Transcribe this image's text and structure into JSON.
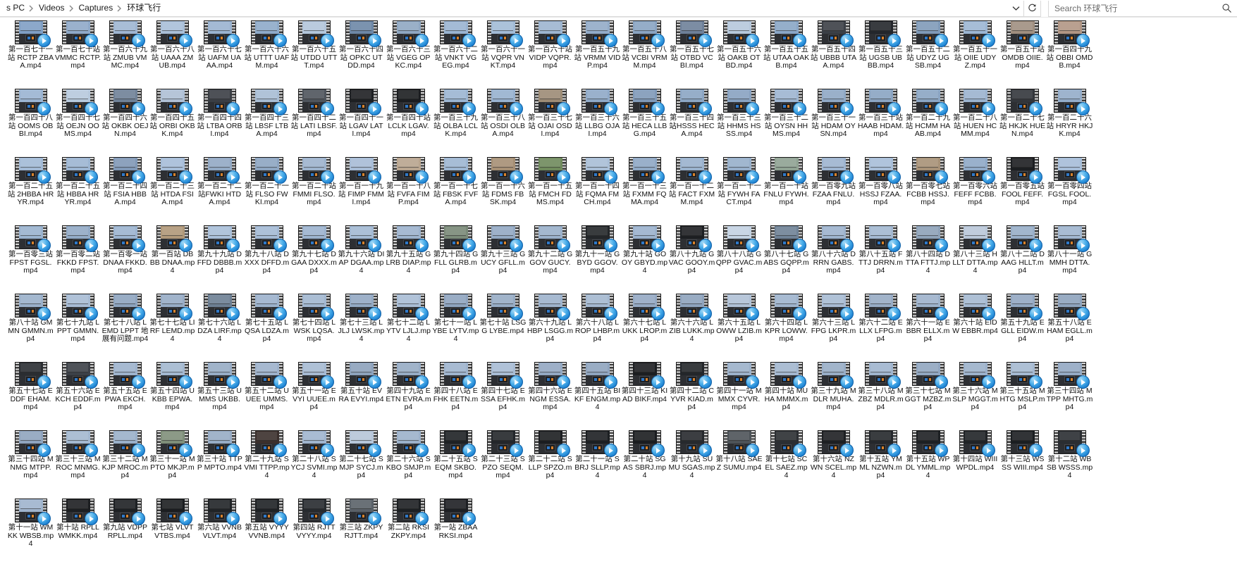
{
  "window": {
    "type": "file-explorer"
  },
  "addressbar": {
    "breadcrumbs": [
      "s PC",
      "Videos",
      "Captures",
      "环球飞行"
    ],
    "dropdown_icon": "chevron-down-icon",
    "refresh_icon": "refresh-icon"
  },
  "search": {
    "placeholder": "Search 环球飞行",
    "value": "",
    "icon": "search-icon"
  },
  "files": [
    {
      "name": "第一百七十一站 RCTP ZBAA.mp4",
      "sky": "#7f9fc4",
      "dark": false
    },
    {
      "name": "第一百七十站 VMMC RCTP.mp4",
      "sky": "#8fa9c8",
      "dark": false
    },
    {
      "name": "第一百六十九站 ZMUB VMMC.mp4",
      "sky": "#9fb6d2",
      "dark": false
    },
    {
      "name": "第一百六十八站 UAAA ZMUB.mp4",
      "sky": "#a9bfd8",
      "dark": false
    },
    {
      "name": "第一百六十七站 UAFM UAAA.mp4",
      "sky": "#9ab3d0",
      "dark": false
    },
    {
      "name": "第一百六十六站 UTTT UAFM.mp4",
      "sky": "#8eaac9",
      "dark": false
    },
    {
      "name": "第一百六十五站 UTDD UTTT.mp4",
      "sky": "#b3c6db",
      "dark": false
    },
    {
      "name": "第一百六十四站 OPKC UTDD.mp4",
      "sky": "#6d87a6",
      "dark": true
    },
    {
      "name": "第一百六十三站 VGEG OPKC.mp4",
      "sky": "#8fa7c2",
      "dark": false
    },
    {
      "name": "第一百六十二站 VNKT VGEG.mp4",
      "sky": "#9ab4d1",
      "dark": false
    },
    {
      "name": "第一百六十一站 VQPR VNKT.mp4",
      "sky": "#a2bbd6",
      "dark": false
    },
    {
      "name": "第一百六十站 VIDP VQPR.mp4",
      "sky": "#9db5d0",
      "dark": false
    },
    {
      "name": "第一百五十九站 VRMM VIDP.mp4",
      "sky": "#92abc8",
      "dark": false
    },
    {
      "name": "第一百五十八站 VCBI VRMM.mp4",
      "sky": "#8aa4c2",
      "dark": false
    },
    {
      "name": "第一百五十七站 OTBD VCBI.mp4",
      "sky": "#6e8099",
      "dark": true
    },
    {
      "name": "第一百五十六站 OAKB OTBD.mp4",
      "sky": "#b6c8dc",
      "dark": false
    },
    {
      "name": "第一百五十五站 UTAA OAKB.mp4",
      "sky": "#8aa6c6",
      "dark": false
    },
    {
      "name": "第一百五十四站 UBBB UTAA.mp4",
      "sky": "#3b3f46",
      "dark": true
    },
    {
      "name": "第一百五十三站 UGSB UBBB.mp4",
      "sky": "#23262b",
      "dark": true
    },
    {
      "name": "第一百五十二站 UDYZ UGSB.mp4",
      "sky": "#7f9ab8",
      "dark": false
    },
    {
      "name": "第一百五十一站 OIIE UDYZ.mp4",
      "sky": "#9cb6d3",
      "dark": false
    },
    {
      "name": "第一百五十站 OMDB OIIE.mp4",
      "sky": "#a08f80",
      "dark": false
    },
    {
      "name": "第一百四十九站 OBBI OMDB.mp4",
      "sky": "#b19684",
      "dark": false
    },
    {
      "name": "第一百四十八站 OOMS OBBI.mp4",
      "sky": "#9ab4d2",
      "dark": false
    },
    {
      "name": "第一百四十七站 OEJN OOMS.mp4",
      "sky": "#b7c9dd",
      "dark": false
    },
    {
      "name": "第一百四十六站 OKBK OEJN.mp4",
      "sky": "#6f8197",
      "dark": true
    },
    {
      "name": "第一百四十五站 ORBI OKBK.mp4",
      "sky": "#aebfd4",
      "dark": false
    },
    {
      "name": "第一百四十四站 LTBA ORBI.mp4",
      "sky": "#3a3e44",
      "dark": true
    },
    {
      "name": "第一百四十三站 LBSF LTBA.mp4",
      "sky": "#a8bdd4",
      "dark": false
    },
    {
      "name": "第一百四十二站 LATI LBSF.mp4",
      "sky": "#4e545c",
      "dark": true
    },
    {
      "name": "第一百四十一站 LGAV LATI.mp4",
      "sky": "#1d1f22",
      "dark": true
    },
    {
      "name": "第一百四十站 LCLK LGAV.mp4",
      "sky": "#1b1d20",
      "dark": true
    },
    {
      "name": "第一百三十九站 OLBA LCLK.mp4",
      "sky": "#9bb5d2",
      "dark": false
    },
    {
      "name": "第一百三十八站 OSDI OLBA.mp4",
      "sky": "#97b1cf",
      "dark": false
    },
    {
      "name": "第一百三十七站 OJAI OSDI.mp4",
      "sky": "#9c8b75",
      "dark": false
    },
    {
      "name": "第一百三十六站 LLBG OJAI.mp4",
      "sky": "#8fa9c7",
      "dark": false
    },
    {
      "name": "第一百三十五站 HECA LLBG.mp4",
      "sky": "#7f99b8",
      "dark": false
    },
    {
      "name": "第一百三十四站HSSS HECA.mp4",
      "sky": "#8ba5c3",
      "dark": false
    },
    {
      "name": "第一百三十三站 HHMS HSSS.mp4",
      "sky": "#88a2c1",
      "dark": false
    },
    {
      "name": "第一百三十二站 OYSN HHMS.mp4",
      "sky": "#9db5d1",
      "dark": false
    },
    {
      "name": "第一百三十一站 HDAM OYSN.mp4",
      "sky": "#8fa8c5",
      "dark": false
    },
    {
      "name": "第一百三十站 HAAB HDAM.mp4",
      "sky": "#8aa4c2",
      "dark": false
    },
    {
      "name": "第一百二十九站 HCMM HAAB.mp4",
      "sky": "#8ba5c3",
      "dark": false
    },
    {
      "name": "第一百二十八站 HUEN HCMM.mp4",
      "sky": "#9bb3cf",
      "dark": false
    },
    {
      "name": "第一百二十七站 HKJK HUEN.mp4",
      "sky": "#33363b",
      "dark": true
    },
    {
      "name": "第一百二十六站 HRYR HKJK.mp4",
      "sky": "#93acc9",
      "dark": false
    },
    {
      "name": "第一百二十五站 2HBBA HRYR.mp4",
      "sky": "#a2bad6",
      "dark": false
    },
    {
      "name": "第一百二十五站 HBBA HRYR.mp4",
      "sky": "#9cb5d2",
      "dark": false
    },
    {
      "name": "第一百二十四站 FSIA HBBA.mp4",
      "sky": "#8098b6",
      "dark": false
    },
    {
      "name": "第一百二十三站 HTDA FSIA.mp4",
      "sky": "#a6bdd8",
      "dark": false
    },
    {
      "name": "第一百二十二站FWKI HTDA.mp4",
      "sky": "#92a9c4",
      "dark": false
    },
    {
      "name": "第一百二十一站 FLSO FWKI.mp4",
      "sky": "#8da5c1",
      "dark": false
    },
    {
      "name": "第一百二十站 FMMI FLSO.mp4",
      "sky": "#9db3cd",
      "dark": false
    },
    {
      "name": "第一百一十九站 FIMP FMMI.mp4",
      "sky": "#a7bcd6",
      "dark": false
    },
    {
      "name": "第一百一十八站 FVFA FIMP.mp4",
      "sky": "#b8a48e",
      "dark": false
    },
    {
      "name": "第一百一十七站 FBSK FVFA.mp4",
      "sky": "#9db6d2",
      "dark": false
    },
    {
      "name": "第一百一十六站 FDMS FBSK.mp4",
      "sky": "#a68f74",
      "dark": false
    },
    {
      "name": "第一百一十五站 FMCH FDMS.mp4",
      "sky": "#6f8a5c",
      "dark": false
    },
    {
      "name": "第一百一十四站 FQMA FMCH.mp4",
      "sky": "#a9bed6",
      "dark": false
    },
    {
      "name": "第一百一十三站 FXMM FQMA.mp4",
      "sky": "#8fa8c4",
      "dark": false
    },
    {
      "name": "第一百一十二站 FACT FXMM.mp4",
      "sky": "#9ab2cd",
      "dark": false
    },
    {
      "name": "第一百一十一站 FYWH FACT.mp4",
      "sky": "#97afca",
      "dark": false
    },
    {
      "name": "第一百一十站 FNLU FYWH.mp4",
      "sky": "#8fa292",
      "dark": false
    },
    {
      "name": "第一百零九站 FZAA FNLU.mp4",
      "sky": "#9db4d0",
      "dark": false
    },
    {
      "name": "第一百零八站 HSSJ FZAA.mp4",
      "sky": "#a8bed8",
      "dark": false
    },
    {
      "name": "第一百零七站 FCBB HSSJ.mp4",
      "sky": "#a79177",
      "dark": false
    },
    {
      "name": "第一百零六站 FEFF FCBB.mp4",
      "sky": "#8fa9c7",
      "dark": false
    },
    {
      "name": "第一百零五站 FOOL FEFF.mp4",
      "sky": "#1c1e21",
      "dark": true
    },
    {
      "name": "第一百零四站 FGSL FOOL.mp4",
      "sky": "#a6bdd8",
      "dark": false
    },
    {
      "name": "第一百零三站 FPST FGSL.mp4",
      "sky": "#9ab3cf",
      "dark": false
    },
    {
      "name": "第一百零二站 FKKD FPST.mp4",
      "sky": "#92aac6",
      "dark": false
    },
    {
      "name": "第一百零一站 DNAA FKKD.mp4",
      "sky": "#9cb4d0",
      "dark": false
    },
    {
      "name": "第一百站 DBBB DNAA.mp4",
      "sky": "#b09879",
      "dark": false
    },
    {
      "name": "第九十九站 DFFD DBBB.mp4",
      "sky": "#a9bfd9",
      "dark": false
    },
    {
      "name": "第九十八站 DXXX DFFD.mp4",
      "sky": "#a4bad5",
      "dark": false
    },
    {
      "name": "第九十七站 DGAA DXXX.mp4",
      "sky": "#9cb3ce",
      "dark": false
    },
    {
      "name": "第九十六站 DIAP DGAA.mp4",
      "sky": "#a3b9d3",
      "dark": false
    },
    {
      "name": "第九十五站 GLRB DIAP.mp4",
      "sky": "#9db3cd",
      "dark": false
    },
    {
      "name": "第九十四站 GFLL GLRB.mp4",
      "sky": "#7a8a78",
      "dark": false
    },
    {
      "name": "第九十三站 GUCY GFLL.mp4",
      "sky": "#93a9c3",
      "dark": false
    },
    {
      "name": "第九十二站 GGOV GUCY.mp4",
      "sky": "#9ab0ca",
      "dark": false
    },
    {
      "name": "第九十一站 GBYD GGOV.mp4",
      "sky": "#232629",
      "dark": true
    },
    {
      "name": "第九十站 GOOY GBYD.mp4",
      "sky": "#9bb2cd",
      "dark": false
    },
    {
      "name": "第八十九站 GVAC GOOY.mp4",
      "sky": "#1d1f22",
      "dark": true
    },
    {
      "name": "第八十八站 GQPP GVAC.mp4",
      "sky": "#c3d2e2",
      "dark": false
    },
    {
      "name": "第八十七站 GABS GQPP.mp4",
      "sky": "#6f8296",
      "dark": false
    },
    {
      "name": "第八十六站 DRRN GABS.mp4",
      "sky": "#9db3cd",
      "dark": false
    },
    {
      "name": "第八十五站 FTTJ DRRN.mp4",
      "sky": "#a3b8d1",
      "dark": false
    },
    {
      "name": "第八十四站 DTTA FTTJ.mp4",
      "sky": "#8ea2b8",
      "dark": false
    },
    {
      "name": "第八十三站 HLLT DTTA.mp4",
      "sky": "#b9c7d8",
      "dark": false
    },
    {
      "name": "第八十二站 DAAG HLLT.mp4",
      "sky": "#98aec8",
      "dark": false
    },
    {
      "name": "第八十一站 GMMH DTTA.mp4",
      "sky": "#a0b5ce",
      "dark": false
    },
    {
      "name": "第八十站 GMMN GMMN.mp4",
      "sky": "#9ab0ca",
      "dark": false
    },
    {
      "name": "第七十九站 LPPT GMMN.mp4",
      "sky": "#a7bbd4",
      "dark": false
    },
    {
      "name": "第七十八站 LEMD LPPT 地展有问题.mp4",
      "sky": "#8ea4bf",
      "dark": false
    },
    {
      "name": "第七十七站 LIRF LEMD.mp4",
      "sky": "#97acc6",
      "dark": false
    },
    {
      "name": "第七十六站 LDZA LIRF.mp4",
      "sky": "#6d7f93",
      "dark": true
    },
    {
      "name": "第七十五站 LQSA LDZA.mp4",
      "sky": "#9cb2cc",
      "dark": false
    },
    {
      "name": "第七十四站 LWSK LQSA.mp4",
      "sky": "#a2b7d0",
      "dark": false
    },
    {
      "name": "第七十三站 LJLJ LWSK.mp4",
      "sky": "#93a9c3",
      "dark": false
    },
    {
      "name": "第七十二站 LYTV LJLJ.mp4",
      "sky": "#a9bdd5",
      "dark": false
    },
    {
      "name": "第七十一站 LYBE LYTV.mp4",
      "sky": "#8fa4bf",
      "dark": false
    },
    {
      "name": "第七十站 LSGG LYBE.mp4",
      "sky": "#97acc5",
      "dark": false
    },
    {
      "name": "第六十九站 LHBP LSGG.mp4",
      "sky": "#9eb3cc",
      "dark": false
    },
    {
      "name": "第六十八站 LROP LHBP.mp4",
      "sky": "#a4b8d0",
      "dark": false
    },
    {
      "name": "第六十七站 LUKK LROP.mp4",
      "sky": "#95a9c3",
      "dark": false
    },
    {
      "name": "第六十六站 LZIB LUKK.mp4",
      "sky": "#8ea3bd",
      "dark": false
    },
    {
      "name": "第六十五站 LOWW LZIB.mp4",
      "sky": "#b0c1d6",
      "dark": false
    },
    {
      "name": "第六十四站 LKPR LOWW.mp4",
      "sky": "#9fb4cd",
      "dark": false
    },
    {
      "name": "第六十三站 LFPG LKPR.mp4",
      "sky": "#a8bbd3",
      "dark": false
    },
    {
      "name": "第六十二站 ELLX LFPG.mp4",
      "sky": "#98acc5",
      "dark": false
    },
    {
      "name": "第六十一站 EBBR ELLX.mp4",
      "sky": "#9db2cb",
      "dark": false
    },
    {
      "name": "第六十站 EIDW EBBR.mp4",
      "sky": "#a5b9d1",
      "dark": false
    },
    {
      "name": "第五十九站 EGLL EIDW.mp4",
      "sky": "#93a8c2",
      "dark": false
    },
    {
      "name": "第五十八站 EHAM EGLL.mp4",
      "sky": "#8ea3bd",
      "dark": false
    },
    {
      "name": "第五十七站 EDDF EHAM.mp4",
      "sky": "#2a2d31",
      "dark": true
    },
    {
      "name": "第五十六站 EKCH EDDF.mp4",
      "sky": "#3c4047",
      "dark": true
    },
    {
      "name": "第五十五站 EPWA EKCH.mp4",
      "sky": "#9eb3cc",
      "dark": false
    },
    {
      "name": "第五十四站 UKBB EPWA.mp4",
      "sky": "#a3b8d0",
      "dark": false
    },
    {
      "name": "第五十三站 UMMS UKBB.mp4",
      "sky": "#97acc5",
      "dark": false
    },
    {
      "name": "第五十二站 UUEE UMMS.mp4",
      "sky": "#9eb2cb",
      "dark": false
    },
    {
      "name": "第五十一站 EVYI UUEE.mp4",
      "sky": "#a6bad2",
      "dark": false
    },
    {
      "name": "第五十站 EVRA EVYI.mp4",
      "sky": "#8da2bc",
      "dark": false
    },
    {
      "name": "第四十九站 EETN EVRA.mp4",
      "sky": "#97acc5",
      "dark": false
    },
    {
      "name": "第四十八站 EFHK EETN.mp4",
      "sky": "#9fb4cd",
      "dark": false
    },
    {
      "name": "第四十七站 ESSA EFHK.mp4",
      "sky": "#a8bcd4",
      "dark": false
    },
    {
      "name": "第四十六站 ENGM ESSA.mp4",
      "sky": "#93a8c2",
      "dark": false
    },
    {
      "name": "第四十五站 BIKF ENGM.mp4",
      "sky": "#8fa4be",
      "dark": false
    },
    {
      "name": "第四十三站 KIAD BIKF.mp4",
      "sky": "#1c1e21",
      "dark": true
    },
    {
      "name": "第四十二站 CYVR KIAD.mp4",
      "sky": "#23262a",
      "dark": true
    },
    {
      "name": "第四十一站 MMMX CYVR.mp4",
      "sky": "#9cb1ca",
      "dark": false
    },
    {
      "name": "第四十站 MUHA MMMX.mp4",
      "sky": "#a3b7cf",
      "dark": false
    },
    {
      "name": "第三十九站 MDLR MUHA.mp4",
      "sky": "#98adc6",
      "dark": false
    },
    {
      "name": "第三十八站 MZBZ MDLR.mp4",
      "sky": "#a0b5ce",
      "dark": false
    },
    {
      "name": "第三十七站 MGGT MZBZ.mp4",
      "sky": "#91a6c0",
      "dark": false
    },
    {
      "name": "第三十六站 MSLP MGGT.mp4",
      "sky": "#9cb1ca",
      "dark": false
    },
    {
      "name": "第三十五站 MHTG MSLP.mp4",
      "sky": "#a5b9d1",
      "dark": false
    },
    {
      "name": "第三十四站 MTPP MHTG.mp4",
      "sky": "#94a9c3",
      "dark": false
    },
    {
      "name": "第三十四站 MNMG MTPP.mp4",
      "sky": "#8fa4be",
      "dark": false
    },
    {
      "name": "第三十三站 MROC MNMG.mp4",
      "sky": "#a3b8d0",
      "dark": false
    },
    {
      "name": "第三十二站 MKJP MROC.mp4",
      "sky": "#9ab0c9",
      "dark": false
    },
    {
      "name": "第三十一站 MPTO MKJP.mp4",
      "sky": "#7f8f7a",
      "dark": false
    },
    {
      "name": "第三十站 TTPP MPTO.mp4",
      "sky": "#97acc5",
      "dark": false
    },
    {
      "name": "第二十九站 SVMI TTPP.mp4",
      "sky": "#3a2f2c",
      "dark": true
    },
    {
      "name": "第二十八站 SYCJ SVMI.mp4",
      "sky": "#a0b5ce",
      "dark": false
    },
    {
      "name": "第二十七站 SMJP SYCJ.mp4",
      "sky": "#b6c6d9",
      "dark": false
    },
    {
      "name": "第二十六站 SKBO SMJP.mp4",
      "sky": "#9cb1ca",
      "dark": false
    },
    {
      "name": "第二十五站 SEQM SKBO.mp4",
      "sky": "#1e2124",
      "dark": true
    },
    {
      "name": "第二十三站 SPZO SEQM.mp4",
      "sky": "#23262a",
      "dark": true
    },
    {
      "name": "第二十二站 SLLP SPZO.mp4",
      "sky": "#1b1d20",
      "dark": true
    },
    {
      "name": "第二十一站 SBRJ SLLP.mp4",
      "sky": "#1c1f22",
      "dark": true
    },
    {
      "name": "第二十站 SGAS SBRJ.mp4",
      "sky": "#1a1c1f",
      "dark": true
    },
    {
      "name": "第十九站 SUMU SGAS.mp4",
      "sky": "#26292d",
      "dark": true
    },
    {
      "name": "第十八站 SAEZ SUMU.mp4",
      "sky": "#4d5358",
      "dark": true
    },
    {
      "name": "第十七站 SCEL SAEZ.mp4",
      "sky": "#2b2e32",
      "dark": true
    },
    {
      "name": "第十六站 NZWN SCEL.mp4",
      "sky": "#1d1f22",
      "dark": true
    },
    {
      "name": "第十五站 YMML NZWN.mp4",
      "sky": "#24272b",
      "dark": true
    },
    {
      "name": "第十五站 WPDL YMML.mp4",
      "sky": "#1d2023",
      "dark": true
    },
    {
      "name": "第十四站 WIII WPDL.mp4",
      "sky": "#202326",
      "dark": true
    },
    {
      "name": "第十三站 WSSS WIII.mp4",
      "sky": "#1b1e21",
      "dark": true
    },
    {
      "name": "第十二站 WBSB WSSS.mp4",
      "sky": "#2a2d31",
      "dark": true
    },
    {
      "name": "第十一站 WMKK WBSB.mp4",
      "sky": "#9fb4cd",
      "dark": false
    },
    {
      "name": "第十站 RPLL WMKK.mp4",
      "sky": "#1c1e21",
      "dark": true
    },
    {
      "name": "第九站 VDPP RPLL.mp4",
      "sky": "#1d2023",
      "dark": true
    },
    {
      "name": "第七站 VLVT VTBS.mp4",
      "sky": "#1b1d20",
      "dark": true
    },
    {
      "name": "第六站 VVNB VLVT.mp4",
      "sky": "#202326",
      "dark": true
    },
    {
      "name": "第五站 VYYY VVNB.mp4",
      "sky": "#1e2124",
      "dark": true
    },
    {
      "name": "第四站 RJTT VYYY.mp4",
      "sky": "#262a2e",
      "dark": true
    },
    {
      "name": "第三站 ZKPY RJTT.mp4",
      "sky": "#5a6168",
      "dark": true
    },
    {
      "name": "第二站 RKSI ZKPY.mp4",
      "sky": "#1c1f22",
      "dark": true
    },
    {
      "name": "第一站 ZBAA RKSI.mp4",
      "sky": "#1d1f23",
      "dark": true
    }
  ],
  "layout": {
    "columns": 23,
    "rows": 8
  }
}
